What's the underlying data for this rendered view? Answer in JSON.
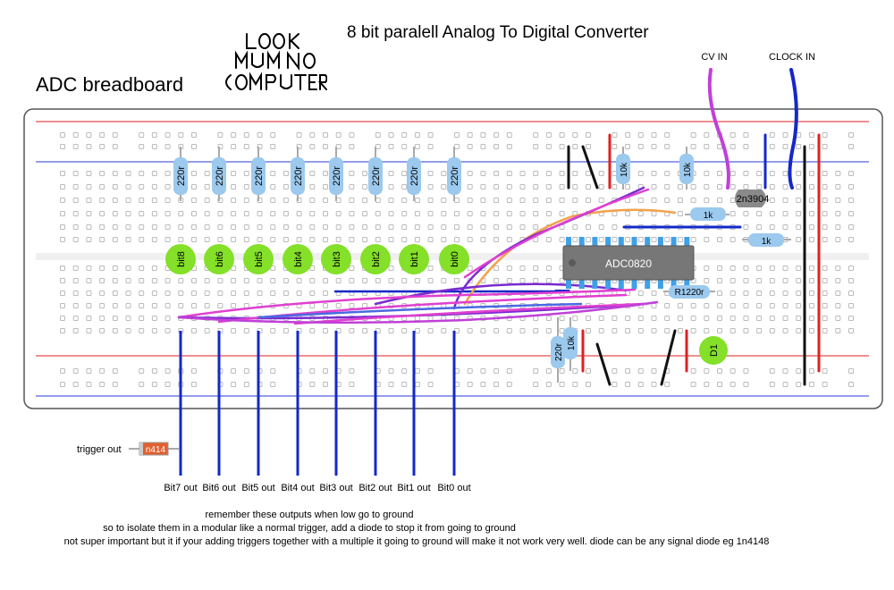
{
  "title": "8 bit paralell Analog To Digital Converter",
  "subtitle": "ADC breadboard",
  "logo": {
    "lines": [
      "LOOK",
      "MUM NO",
      "COMPUTER"
    ]
  },
  "inputs": {
    "cv": "CV IN",
    "clock": "CLOCK IN"
  },
  "resistors_top": [
    "220r",
    "220r",
    "220r",
    "220r",
    "220r",
    "220r",
    "220r",
    "220r"
  ],
  "resistors_misc": {
    "r10k_a": "10k",
    "r10k_b": "10k",
    "r1k_a": "1k",
    "r1k_b": "1k",
    "r10k_c": "10k",
    "r220_c": "220r",
    "r1220": "R1220r"
  },
  "leds": [
    "bit8",
    "bit6",
    "bit5",
    "bit4",
    "bit3",
    "bit2",
    "bit1",
    "bit0"
  ],
  "chip": "ADC0820",
  "transistor": "2n3904",
  "diode_led": "D1",
  "outputs": [
    "Bit7 out",
    "Bit6 out",
    "Bit5 out",
    "Bit4 out",
    "Bit3 out",
    "Bit2 out",
    "Bit1 out",
    "Bit0 out"
  ],
  "trigger": {
    "label": "trigger out",
    "diode": "n414"
  },
  "notes": [
    "remember these outputs when low go to ground",
    "so to isolate them in a modular like a normal trigger, add a diode to stop it from going to ground",
    "not super important but it if your adding triggers together with a multiple it going to ground will make it not work very well. diode can be any signal diode eg 1n4148"
  ],
  "colors": {
    "red_rail": "#e02020",
    "blue_rail": "#2a3bd6",
    "wire_blue": "#1428c8",
    "wire_magenta": "#e040d0",
    "wire_purple": "#7a2ad0",
    "wire_orange": "#f2a24a",
    "resistor": "#9cc9ee",
    "led": "#84e028",
    "chip": "#777777"
  }
}
